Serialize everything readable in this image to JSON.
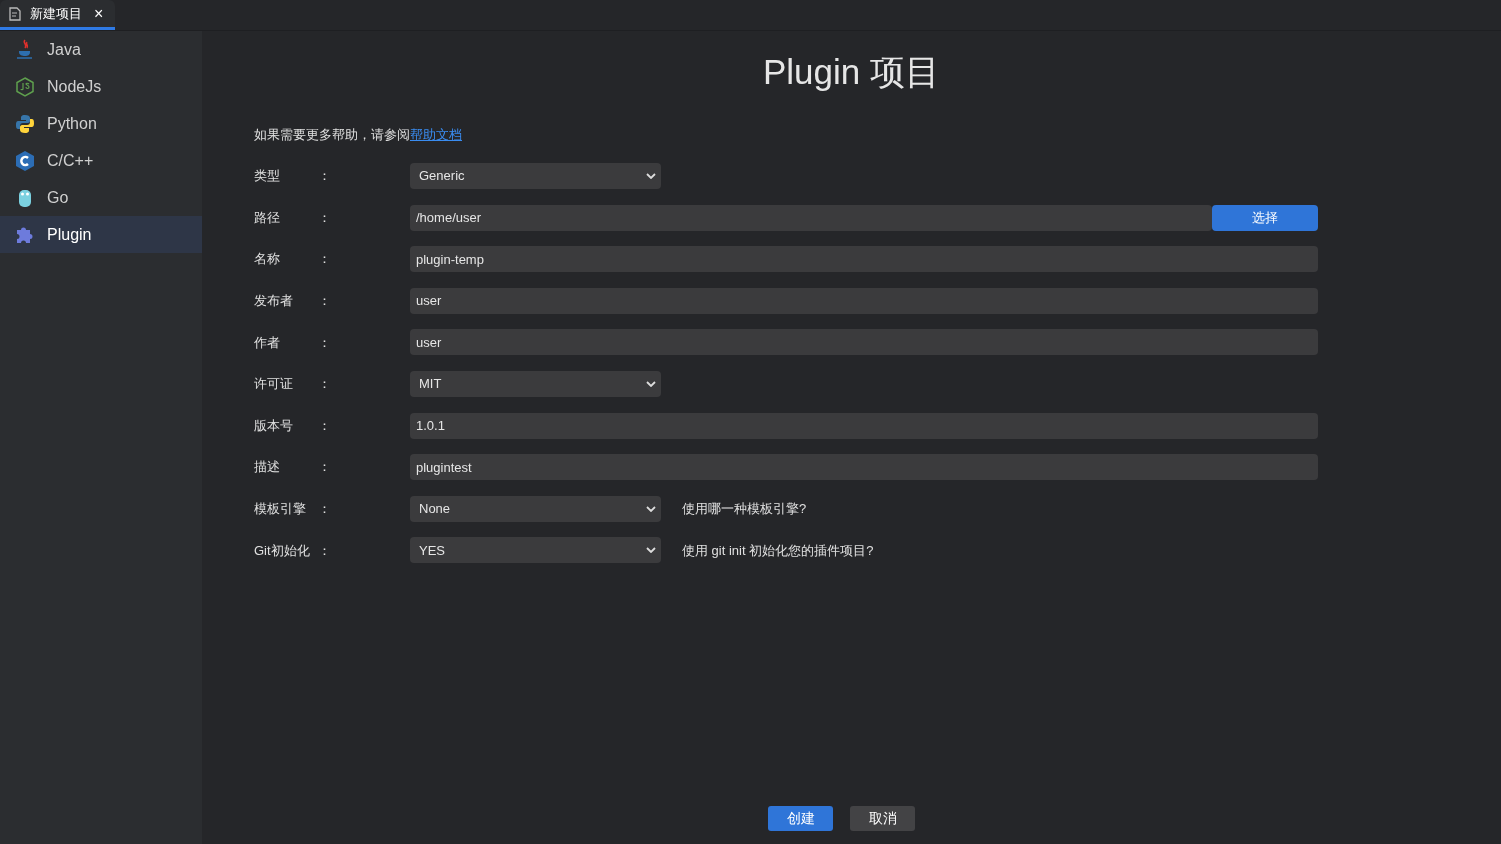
{
  "tab": {
    "title": "新建项目",
    "close": "×",
    "selected": true
  },
  "sidebar": {
    "items": [
      {
        "label": "Java",
        "kind": "java",
        "selected": false
      },
      {
        "label": "NodeJs",
        "kind": "node",
        "selected": false
      },
      {
        "label": "Python",
        "kind": "python",
        "selected": false
      },
      {
        "label": "C/C++",
        "kind": "cpp",
        "selected": false
      },
      {
        "label": "Go",
        "kind": "go",
        "selected": false
      },
      {
        "label": "Plugin",
        "kind": "plugin",
        "selected": true
      }
    ]
  },
  "title": "Plugin 项目",
  "help": {
    "text": "如果需要更多帮助，请参阅",
    "link": "帮助文档"
  },
  "fields": [
    {
      "label": "类型",
      "kind": "select",
      "value": "Generic"
    },
    {
      "label": "路径",
      "kind": "path",
      "value": "/home/user",
      "button": "选择"
    },
    {
      "label": "名称",
      "kind": "text",
      "value": "plugin-temp"
    },
    {
      "label": "发布者",
      "kind": "text",
      "value": "user"
    },
    {
      "label": "作者",
      "kind": "text",
      "value": "user"
    },
    {
      "label": "许可证",
      "kind": "select",
      "value": "MIT"
    },
    {
      "label": "版本号",
      "kind": "text",
      "value": "1.0.1"
    },
    {
      "label": "描述",
      "kind": "text",
      "value": "plugintest"
    },
    {
      "label": "模板引擎",
      "kind": "select",
      "value": "None",
      "hint": "使用哪一种模板引擎?"
    },
    {
      "label": "Git初始化",
      "kind": "select",
      "value": "YES",
      "hint": "使用 git init 初始化您的插件项目?"
    }
  ],
  "colon": "：",
  "buttons": [
    {
      "label": "创建",
      "kind": "primary"
    },
    {
      "label": "取消",
      "kind": "secondary"
    }
  ]
}
